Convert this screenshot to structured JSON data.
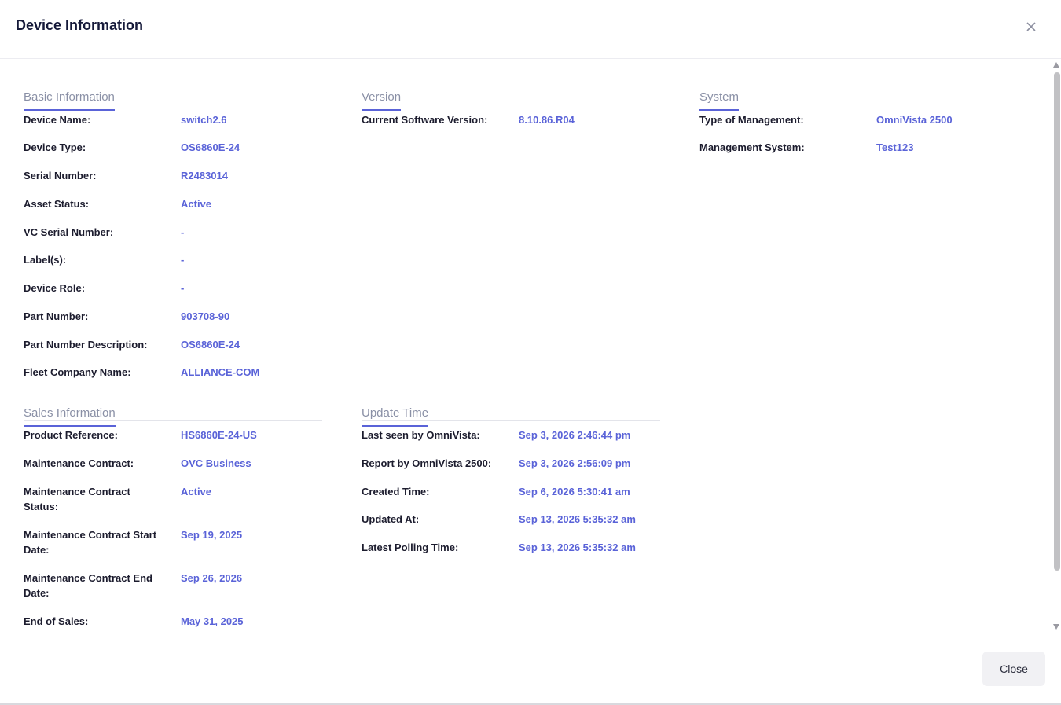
{
  "dialog": {
    "title": "Device Information",
    "close_icon": "close-icon",
    "close_button_label": "Close"
  },
  "sections": {
    "basic": {
      "title": "Basic Information",
      "rows": [
        {
          "label": "Device Name:",
          "value": "switch2.6"
        },
        {
          "label": "Device Type:",
          "value": "OS6860E-24"
        },
        {
          "label": "Serial Number:",
          "value": "R2483014"
        },
        {
          "label": "Asset Status:",
          "value": "Active"
        },
        {
          "label": "VC Serial Number:",
          "value": "-"
        },
        {
          "label": "Label(s):",
          "value": "-"
        },
        {
          "label": "Device Role:",
          "value": "-"
        },
        {
          "label": "Part Number:",
          "value": "903708-90"
        },
        {
          "label": "Part Number Description:",
          "value": "OS6860E-24"
        },
        {
          "label": "Fleet Company Name:",
          "value": "ALLIANCE-COM"
        }
      ]
    },
    "version": {
      "title": "Version",
      "rows": [
        {
          "label": "Current Software Version:",
          "value": "8.10.86.R04"
        }
      ]
    },
    "system": {
      "title": "System",
      "rows": [
        {
          "label": "Type of Management:",
          "value": "OmniVista 2500"
        },
        {
          "label": "Management System:",
          "value": "Test123"
        }
      ]
    },
    "sales": {
      "title": "Sales Information",
      "rows": [
        {
          "label": "Product Reference:",
          "value": "HS6860E-24-US"
        },
        {
          "label": "Maintenance Contract:",
          "value": "OVC Business"
        },
        {
          "label": "Maintenance Contract Status:",
          "value": "Active"
        },
        {
          "label": "Maintenance Contract Start Date:",
          "value": "Sep 19, 2025"
        },
        {
          "label": "Maintenance Contract End Date:",
          "value": "Sep 26, 2026"
        },
        {
          "label": "End of Sales:",
          "value": "May 31, 2025"
        }
      ]
    },
    "update": {
      "title": "Update Time",
      "rows": [
        {
          "label": "Last seen by OmniVista:",
          "value": "Sep 3, 2026 2:46:44 pm"
        },
        {
          "label": "Report by OmniVista 2500:",
          "value": "Sep 3, 2026 2:56:09 pm"
        },
        {
          "label": "Created Time:",
          "value": "Sep 6, 2026 5:30:41 am"
        },
        {
          "label": "Updated At:",
          "value": "Sep 13, 2026 5:35:32 am"
        },
        {
          "label": "Latest Polling Time:",
          "value": "Sep 13, 2026 5:35:32 am"
        }
      ]
    }
  }
}
